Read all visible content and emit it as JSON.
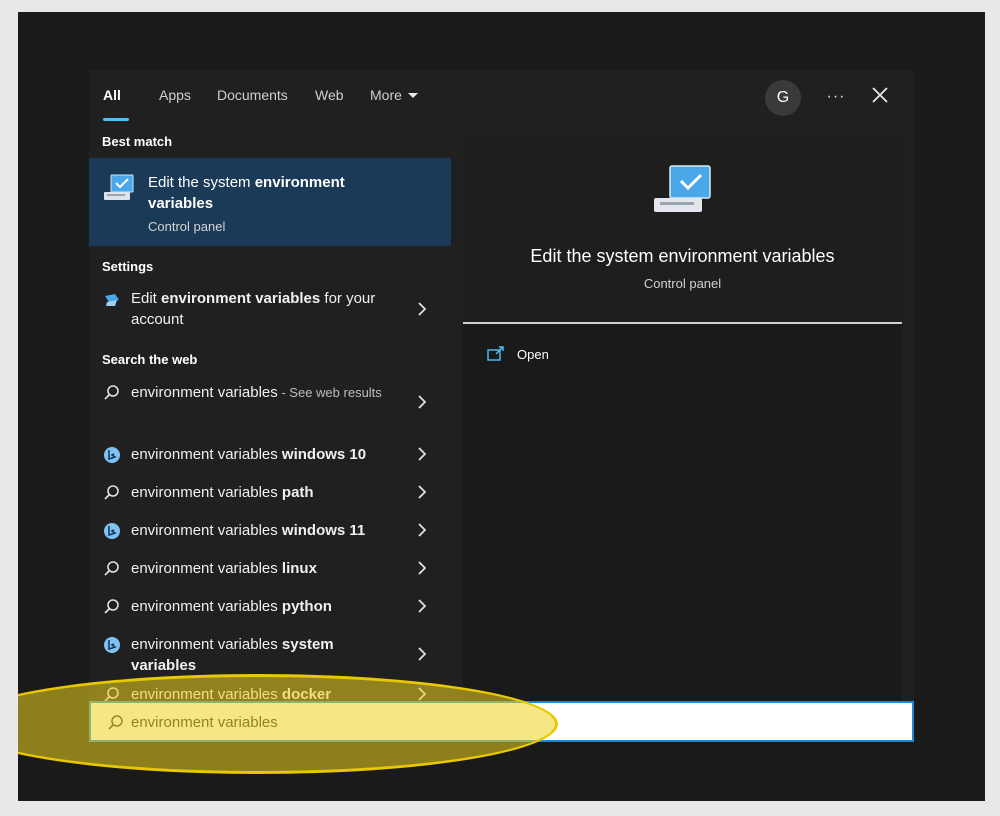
{
  "tabs": [
    {
      "label": "All",
      "active": true
    },
    {
      "label": "Apps"
    },
    {
      "label": "Documents"
    },
    {
      "label": "Web"
    },
    {
      "label": "More"
    }
  ],
  "header": {
    "avatar": "G",
    "more": "···"
  },
  "left": {
    "best_match_heading": "Best match",
    "best_match": {
      "title_plain": "Edit the system ",
      "title_bold": "environment variables",
      "subtitle": "Control panel",
      "icon": "monitor-check-icon"
    },
    "settings_heading": "Settings",
    "settings_item": {
      "pre": "Edit ",
      "bold": "environment variables",
      "post": " for your account",
      "icon": "settings-icon"
    },
    "web_heading": "Search the web",
    "web_first": {
      "text": "environment variables",
      "suffix": " - See web results"
    },
    "web_items": [
      {
        "plain": "environment variables ",
        "bold": "windows 10",
        "icon": "bing-icon"
      },
      {
        "plain": "environment variables ",
        "bold": "path",
        "icon": "search-icon"
      },
      {
        "plain": "environment variables ",
        "bold": "windows 11",
        "icon": "bing-icon"
      },
      {
        "plain": "environment variables ",
        "bold": "linux",
        "icon": "search-icon"
      },
      {
        "plain": "environment variables ",
        "bold": "python",
        "icon": "search-icon"
      },
      {
        "plain": "environment variables ",
        "bold": "system variables",
        "icon": "bing-icon"
      },
      {
        "plain": "environment variables ",
        "bold": "docker",
        "icon": "search-icon"
      }
    ]
  },
  "detail": {
    "title": "Edit the system environment variables",
    "subtitle": "Control panel",
    "action_open": "Open"
  },
  "search": {
    "value": "environment variables"
  },
  "colors": {
    "accent": "#4cc2ff",
    "selected": "#1a3a57",
    "highlight": "#ecd41e"
  }
}
